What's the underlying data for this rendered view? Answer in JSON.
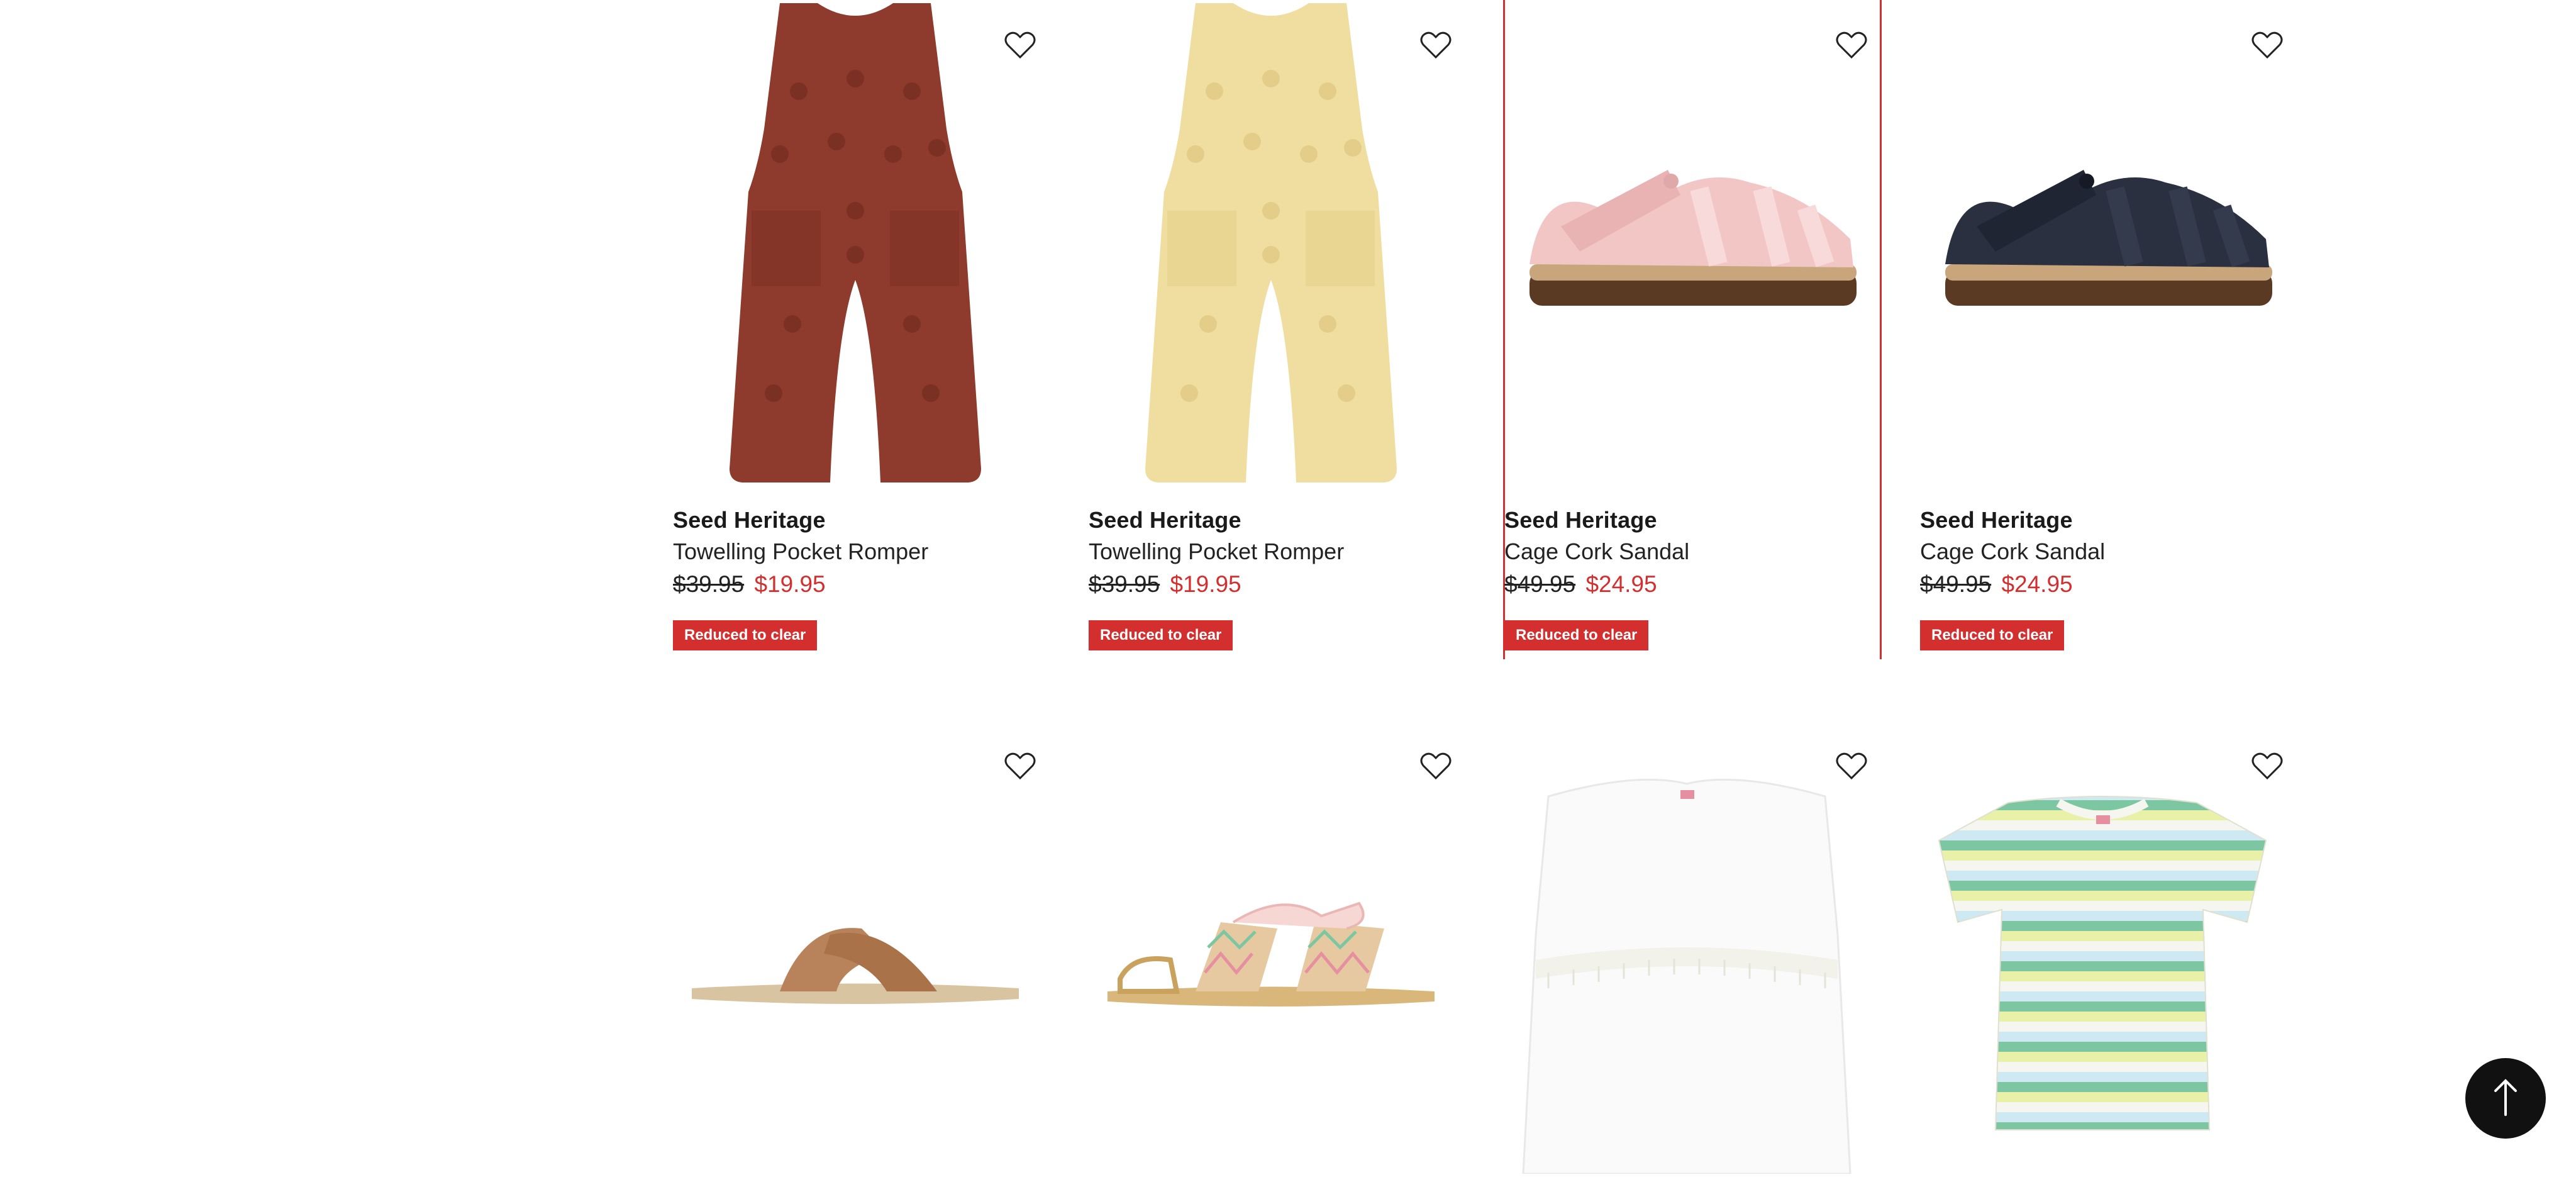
{
  "products": [
    {
      "brand": "Seed Heritage",
      "name": "Towelling Pocket Romper",
      "was": "$39.95",
      "now": "$19.95",
      "badge": "Reduced to clear",
      "image": "rust-romper",
      "color": "#8e3a2c"
    },
    {
      "brand": "Seed Heritage",
      "name": "Towelling Pocket Romper",
      "was": "$39.95",
      "now": "$19.95",
      "badge": "Reduced to clear",
      "image": "yellow-romper",
      "color": "#f0dea0"
    },
    {
      "brand": "Seed Heritage",
      "name": "Cage Cork Sandal",
      "was": "$49.95",
      "now": "$24.95",
      "badge": "Reduced to clear",
      "image": "pink-sandal",
      "color": "#f3c6c6"
    },
    {
      "brand": "Seed Heritage",
      "name": "Cage Cork Sandal",
      "was": "$49.95",
      "now": "$24.95",
      "badge": "Reduced to clear",
      "image": "navy-sandal",
      "color": "#2a3040"
    },
    {
      "image": "tan-slide-sandal",
      "color": "#b8835a"
    },
    {
      "image": "woven-lace-sandal",
      "color": "#d9b77a"
    },
    {
      "image": "white-frill-top",
      "color": "#fafafa"
    },
    {
      "image": "striped-tee",
      "color": "#7cc7a2"
    }
  ],
  "icons": {
    "wishlist": "heart-outline-icon",
    "back_to_top": "arrow-up-icon"
  },
  "colors": {
    "sale": "#d32f2f",
    "text": "#1a1a1a"
  }
}
